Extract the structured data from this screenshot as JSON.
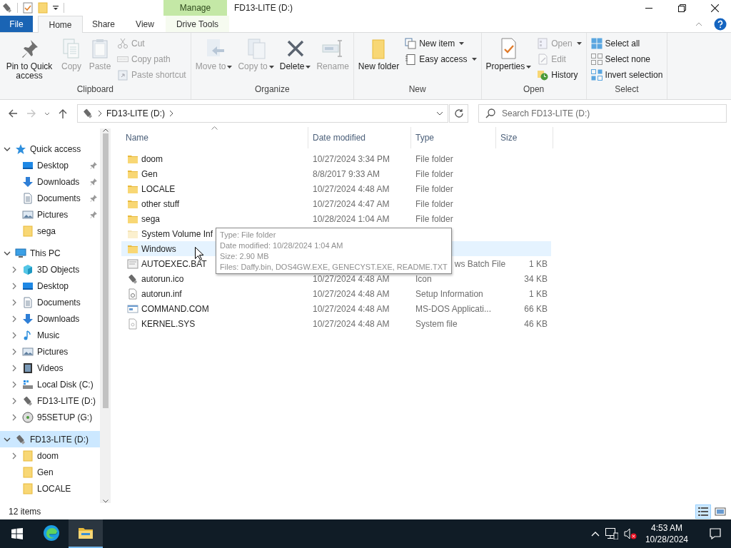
{
  "title_bar": {
    "contextual_tab": "Manage",
    "title": "FD13-LITE (D:)"
  },
  "ribbon_tabs": [
    {
      "label": "File",
      "kind": "file",
      "selected": false
    },
    {
      "label": "Home",
      "kind": "tab",
      "selected": true
    },
    {
      "label": "Share",
      "kind": "tab",
      "selected": false
    },
    {
      "label": "View",
      "kind": "tab",
      "selected": false
    },
    {
      "label": "Drive Tools",
      "kind": "contextual",
      "selected": false
    }
  ],
  "ribbon_groups": [
    {
      "label": "Clipboard",
      "commands": [
        {
          "kind": "large",
          "label": "Pin to Quick access",
          "disabled": false,
          "dropdown": false
        },
        {
          "kind": "large",
          "label": "Copy",
          "disabled": true,
          "dropdown": false
        },
        {
          "kind": "large",
          "label": "Paste",
          "disabled": true,
          "dropdown": false
        },
        {
          "kind": "stack",
          "items": [
            {
              "label": "Cut",
              "disabled": true,
              "dropdown": false
            },
            {
              "label": "Copy path",
              "disabled": true,
              "dropdown": false
            },
            {
              "label": "Paste shortcut",
              "disabled": true,
              "dropdown": false
            }
          ]
        }
      ]
    },
    {
      "label": "Organize",
      "commands": [
        {
          "kind": "large",
          "label": "Move to",
          "disabled": true,
          "dropdown": true
        },
        {
          "kind": "large",
          "label": "Copy to",
          "disabled": true,
          "dropdown": true
        },
        {
          "kind": "large",
          "label": "Delete",
          "disabled": false,
          "dropdown": true
        },
        {
          "kind": "large",
          "label": "Rename",
          "disabled": true,
          "dropdown": false
        }
      ]
    },
    {
      "label": "New",
      "commands": [
        {
          "kind": "large",
          "label": "New folder",
          "disabled": false,
          "dropdown": false
        },
        {
          "kind": "stack",
          "items": [
            {
              "label": "New item",
              "disabled": false,
              "dropdown": true
            },
            {
              "label": "Easy access",
              "disabled": false,
              "dropdown": true
            }
          ]
        }
      ]
    },
    {
      "label": "Open",
      "commands": [
        {
          "kind": "large",
          "label": "Properties",
          "disabled": false,
          "dropdown": true
        },
        {
          "kind": "stack",
          "items": [
            {
              "label": "Open",
              "disabled": true,
              "dropdown": true
            },
            {
              "label": "Edit",
              "disabled": true,
              "dropdown": false
            },
            {
              "label": "History",
              "disabled": false,
              "dropdown": false
            }
          ]
        }
      ]
    },
    {
      "label": "Select",
      "commands": [
        {
          "kind": "stack",
          "items": [
            {
              "label": "Select all",
              "disabled": false,
              "dropdown": false
            },
            {
              "label": "Select none",
              "disabled": false,
              "dropdown": false
            },
            {
              "label": "Invert selection",
              "disabled": false,
              "dropdown": false
            }
          ]
        }
      ]
    }
  ],
  "navigation": {
    "back_disabled": false,
    "forward_disabled": true,
    "up_disabled": false
  },
  "address": {
    "segments": [
      "FD13-LITE (D:)"
    ]
  },
  "search": {
    "placeholder": "Search FD13-LITE (D:)"
  },
  "nav_tree": [
    {
      "label": "Quick access",
      "kind": "star",
      "expanded": true,
      "selected": false,
      "children": [
        {
          "label": "Desktop",
          "kind": "desktop",
          "selected": false,
          "pinned": true
        },
        {
          "label": "Downloads",
          "kind": "downloads",
          "selected": false,
          "pinned": true
        },
        {
          "label": "Documents",
          "kind": "documents",
          "selected": false,
          "pinned": true
        },
        {
          "label": "Pictures",
          "kind": "pictures",
          "selected": false,
          "pinned": true
        },
        {
          "label": "sega",
          "kind": "folder",
          "selected": false,
          "pinned": false
        }
      ]
    },
    {
      "label": "This PC",
      "kind": "pc",
      "expanded": true,
      "selected": false,
      "children": [
        {
          "label": "3D Objects",
          "kind": "cube",
          "expanded": false,
          "selected": false
        },
        {
          "label": "Desktop",
          "kind": "desktop",
          "expanded": false,
          "selected": false
        },
        {
          "label": "Documents",
          "kind": "documents",
          "expanded": false,
          "selected": false
        },
        {
          "label": "Downloads",
          "kind": "downloads",
          "expanded": false,
          "selected": false
        },
        {
          "label": "Music",
          "kind": "music",
          "expanded": false,
          "selected": false
        },
        {
          "label": "Pictures",
          "kind": "pictures",
          "expanded": false,
          "selected": false
        },
        {
          "label": "Videos",
          "kind": "videos",
          "expanded": false,
          "selected": false
        },
        {
          "label": "Local Disk (C:)",
          "kind": "disk",
          "expanded": false,
          "selected": false
        },
        {
          "label": "FD13-LITE (D:)",
          "kind": "usb",
          "expanded": false,
          "selected": false
        },
        {
          "label": "95SETUP (G:)",
          "kind": "cd",
          "expanded": false,
          "selected": false
        }
      ]
    },
    {
      "label": "FD13-LITE (D:)",
      "kind": "usb",
      "expanded": true,
      "selected": true,
      "children": [
        {
          "label": "doom",
          "kind": "folder",
          "expanded": false,
          "selected": false
        },
        {
          "label": "Gen",
          "kind": "folder",
          "selected": false
        },
        {
          "label": "LOCALE",
          "kind": "folder",
          "selected": false
        }
      ]
    }
  ],
  "file_list": {
    "columns": [
      {
        "label": "Name",
        "sorted": true
      },
      {
        "label": "Date modified",
        "sorted": false
      },
      {
        "label": "Type",
        "sorted": false
      },
      {
        "label": "Size",
        "sorted": false
      }
    ],
    "rows": [
      {
        "kind": "folder",
        "name": "doom",
        "date": "10/27/2024 3:34 PM",
        "type": "File folder",
        "hovered": false
      },
      {
        "kind": "folder",
        "name": "Gen",
        "date": "8/8/2017 9:33 AM",
        "type": "File folder",
        "hovered": false
      },
      {
        "kind": "folder",
        "name": "LOCALE",
        "date": "10/27/2024 4:48 AM",
        "type": "File folder",
        "hovered": false
      },
      {
        "kind": "folder",
        "name": "other stuff",
        "date": "10/27/2024 4:47 AM",
        "type": "File folder",
        "hovered": false
      },
      {
        "kind": "folder",
        "name": "sega",
        "date": "10/28/2024 1:04 AM",
        "type": "File folder",
        "hovered": false
      },
      {
        "kind": "hidden-folder",
        "name": "System Volume Inf",
        "hovered": false
      },
      {
        "kind": "folder",
        "name": "Windows",
        "hovered": true
      },
      {
        "kind": "batch",
        "name": "AUTOEXEC.BAT",
        "type": "ws Batch File",
        "size": "1 KB",
        "hovered": false
      },
      {
        "kind": "drive-icon",
        "name": "autorun.ico",
        "date": "10/27/2024 4:48 AM",
        "type": "Icon",
        "size": "34 KB",
        "hovered": false
      },
      {
        "kind": "setup",
        "name": "autorun.inf",
        "date": "10/27/2024 4:48 AM",
        "type": "Setup Information",
        "size": "1 KB",
        "hovered": false
      },
      {
        "kind": "app",
        "name": "COMMAND.COM",
        "date": "10/27/2024 4:48 AM",
        "type": "MS-DOS Applicati...",
        "size": "66 KB",
        "hovered": false
      },
      {
        "kind": "system",
        "name": "KERNEL.SYS",
        "date": "10/27/2024 4:48 AM",
        "type": "System file",
        "size": "46 KB",
        "hovered": false
      }
    ]
  },
  "tooltip": {
    "lines": [
      "Type: File folder",
      "Date modified: 10/28/2024 1:04 AM",
      "Size: 2.90 MB",
      "Files: Daffy.bin, DOS4GW.EXE, GENECYST.EXE, README.TXT"
    ]
  },
  "status_bar": {
    "item_count": "12 items",
    "views": [
      {
        "selected": true
      },
      {
        "selected": false
      }
    ]
  },
  "taskbar": {
    "apps": [
      {
        "active": false
      },
      {
        "active": true
      }
    ],
    "time": "4:53 AM",
    "date": "10/28/2024"
  }
}
